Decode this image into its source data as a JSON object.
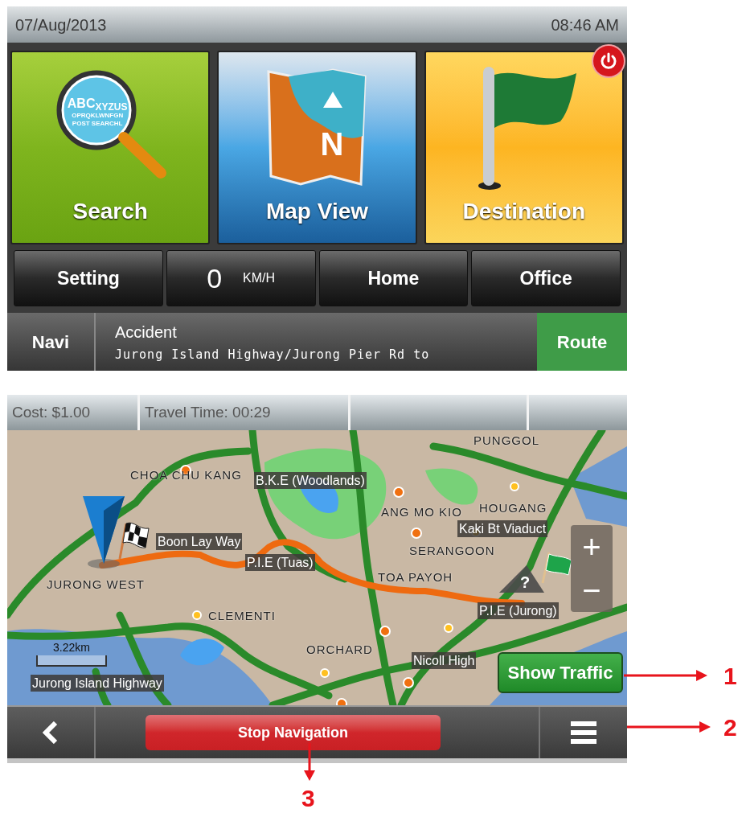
{
  "home_screen": {
    "date": "07/Aug/2013",
    "time": "08:46 AM",
    "tiles": [
      {
        "kind": "search",
        "label": "Search",
        "icon_text": [
          "ABC$_{XYZUS}$",
          "OPRQKLWNFGN",
          "POST SEARCHL"
        ]
      },
      {
        "kind": "map",
        "label": "Map View",
        "icon_text": [
          "N"
        ]
      },
      {
        "kind": "destination",
        "label": "Destination"
      }
    ],
    "buttons": [
      {
        "kind": "button",
        "label": "Setting"
      },
      {
        "kind": "speed",
        "value": "0",
        "unit": "KM/H"
      },
      {
        "kind": "button",
        "label": "Home"
      },
      {
        "kind": "button",
        "label": "Office"
      }
    ],
    "status_bar": {
      "navi": "Navi",
      "alert_title": "Accident",
      "alert_detail": "Jurong Island Highway/Jurong Pier Rd to",
      "route": "Route"
    }
  },
  "map_screen": {
    "info_bar": [
      "Cost: $1.00",
      "Travel Time: 00:29"
    ],
    "map_labels": [
      {
        "kind": "area",
        "text": "PUNGGOL"
      },
      {
        "kind": "area",
        "text": "CHOA CHU KANG"
      },
      {
        "kind": "road",
        "text": "B.K.E (Woodlands)"
      },
      {
        "kind": "area",
        "text": "ANG MO KIO"
      },
      {
        "kind": "area",
        "text": "HOUGANG"
      },
      {
        "kind": "road",
        "text": "Boon Lay Way"
      },
      {
        "kind": "area",
        "text": "JURONG WEST"
      },
      {
        "kind": "area",
        "text": "SERANGOON"
      },
      {
        "kind": "road",
        "text": "Kaki Bt Viaduct"
      },
      {
        "kind": "road",
        "text": "P.I.E (Tuas)"
      },
      {
        "kind": "area",
        "text": "TOA PAYOH"
      },
      {
        "kind": "road",
        "text": "P.I.E (Jurong)"
      },
      {
        "kind": "area",
        "text": "CLEMENTI"
      },
      {
        "kind": "area",
        "text": "ORCHARD"
      },
      {
        "kind": "road",
        "text": "Nicoll High"
      },
      {
        "kind": "road",
        "text": "Jurong Island Highway"
      }
    ],
    "scale": "3.22km",
    "cursor_mark": "?",
    "zoom_in": "+",
    "zoom_out": "−",
    "show_traffic": "Show Traffic",
    "stop_navigation": "Stop Navigation"
  },
  "annotations": [
    {
      "label": "1"
    },
    {
      "label": "2"
    },
    {
      "label": "3"
    }
  ]
}
